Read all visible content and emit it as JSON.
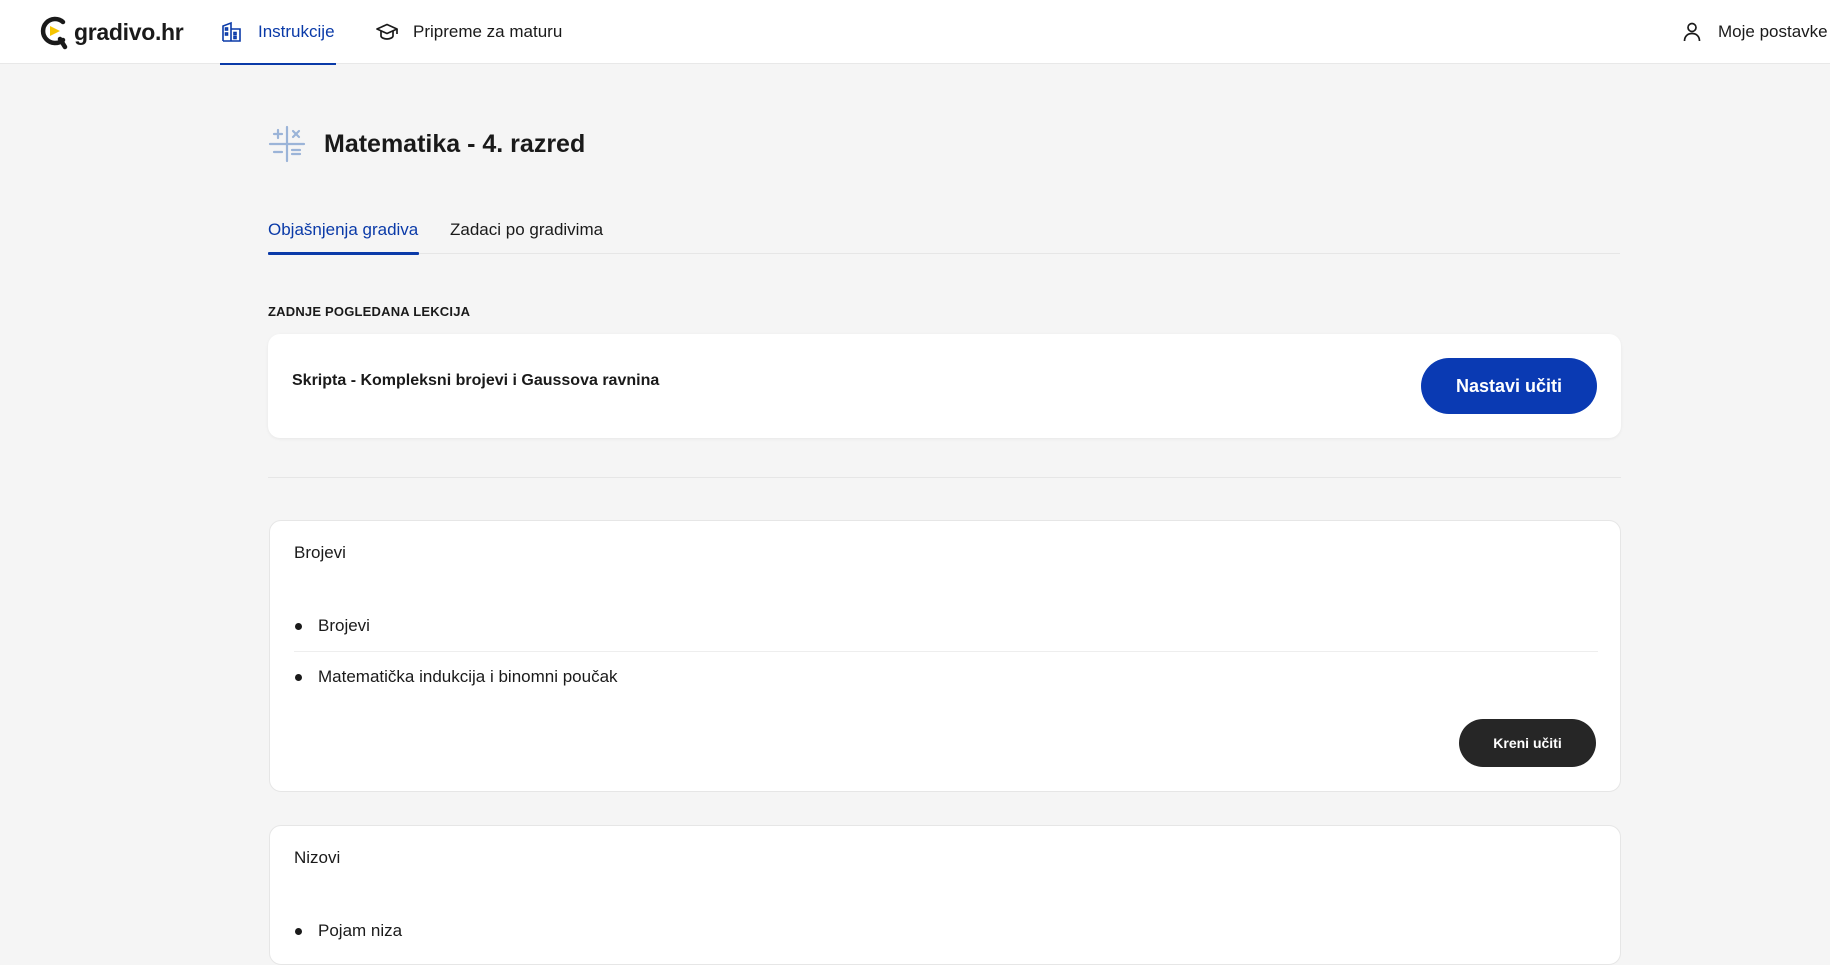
{
  "header": {
    "logo_text": "gradivo.hr",
    "nav": [
      {
        "label": "Instrukcije",
        "icon": "building-icon",
        "active": true
      },
      {
        "label": "Pripreme za maturu",
        "icon": "graduation-cap-icon",
        "active": false
      }
    ],
    "user_label": "Moje postavke"
  },
  "page": {
    "title": "Matematika - 4. razred",
    "icon": "math-operators-icon"
  },
  "tabs": [
    {
      "label": "Objašnjenja gradiva",
      "active": true
    },
    {
      "label": "Zadaci po gradivima",
      "active": false
    }
  ],
  "last_viewed": {
    "section_label": "ZADNJE POGLEDANA LEKCIJA",
    "lesson": "Skripta - Kompleksni brojevi i Gaussova ravnina",
    "button_label": "Nastavi učiti"
  },
  "topics": [
    {
      "title": "Brojevi",
      "items": [
        "Brojevi",
        "Matematička indukcija i binomni poučak"
      ],
      "button_label": "Kreni učiti"
    },
    {
      "title": "Nizovi",
      "items": [
        "Pojam niza"
      ]
    }
  ],
  "colors": {
    "accent": "#0a3ab3",
    "active_text": "#0a3aa8",
    "dark_button": "#262626",
    "background": "#f5f5f5",
    "logo_accent": "#f5c400"
  }
}
